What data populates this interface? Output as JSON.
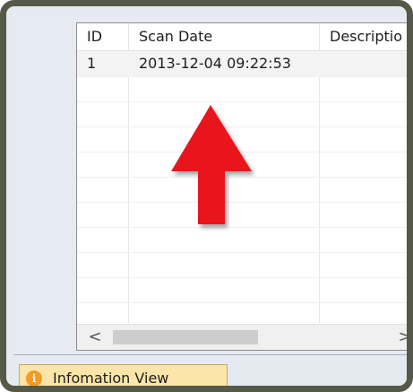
{
  "grid": {
    "columns": [
      "ID",
      "Scan Date",
      "Descriptio"
    ],
    "rows": [
      {
        "id": "1",
        "scan_date": "2013-12-04  09:22:53",
        "description": ""
      }
    ]
  },
  "scrollbar": {
    "left_arrow": "<",
    "right_arrow": ">"
  },
  "tab": {
    "label": "Infomation View",
    "icon": "info-icon"
  },
  "colors": {
    "frame": "#545948",
    "arrow": "#e8171b",
    "tab_bg": "#fbe5a8",
    "info_icon": "#f59a23"
  }
}
